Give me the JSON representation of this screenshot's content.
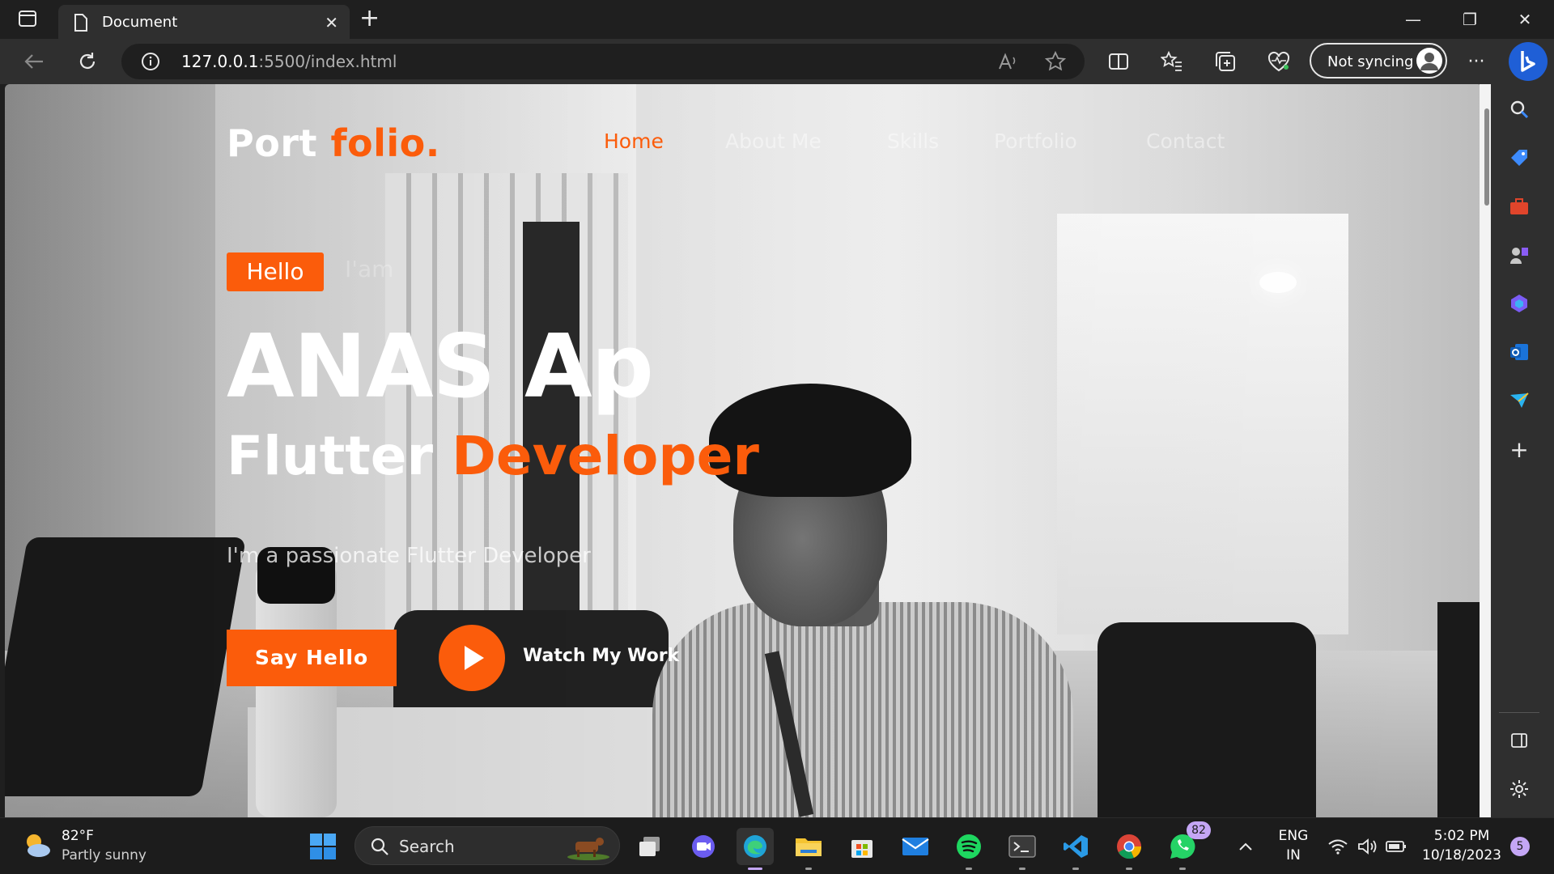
{
  "browser": {
    "tab_title": "Document",
    "url_host": "127.0.0.1",
    "url_rest": ":5500/index.html",
    "sync_label": "Not syncing"
  },
  "site": {
    "logo_main": "Port ",
    "logo_accent": "folio.",
    "nav": [
      "Home",
      "About Me",
      "Skills",
      "Portfolio",
      "Contact"
    ],
    "nav_active": "Home",
    "hello_badge": "Hello",
    "intro_faded": "I'am",
    "name": "ANAS Ap",
    "role_main": "Flutter ",
    "role_accent": "Developer",
    "tagline": "I'm a passionate Flutter Developer",
    "primary_button": "Say Hello",
    "secondary_link": "Watch My Work",
    "accent_color": "#fb5c0b"
  },
  "taskbar": {
    "temperature": "82°F",
    "condition": "Partly sunny",
    "search_label": "Search",
    "whatsapp_badge": "82",
    "lang_top": "ENG",
    "lang_bottom": "IN",
    "time": "5:02 PM",
    "date": "10/18/2023",
    "notification_count": "5"
  }
}
